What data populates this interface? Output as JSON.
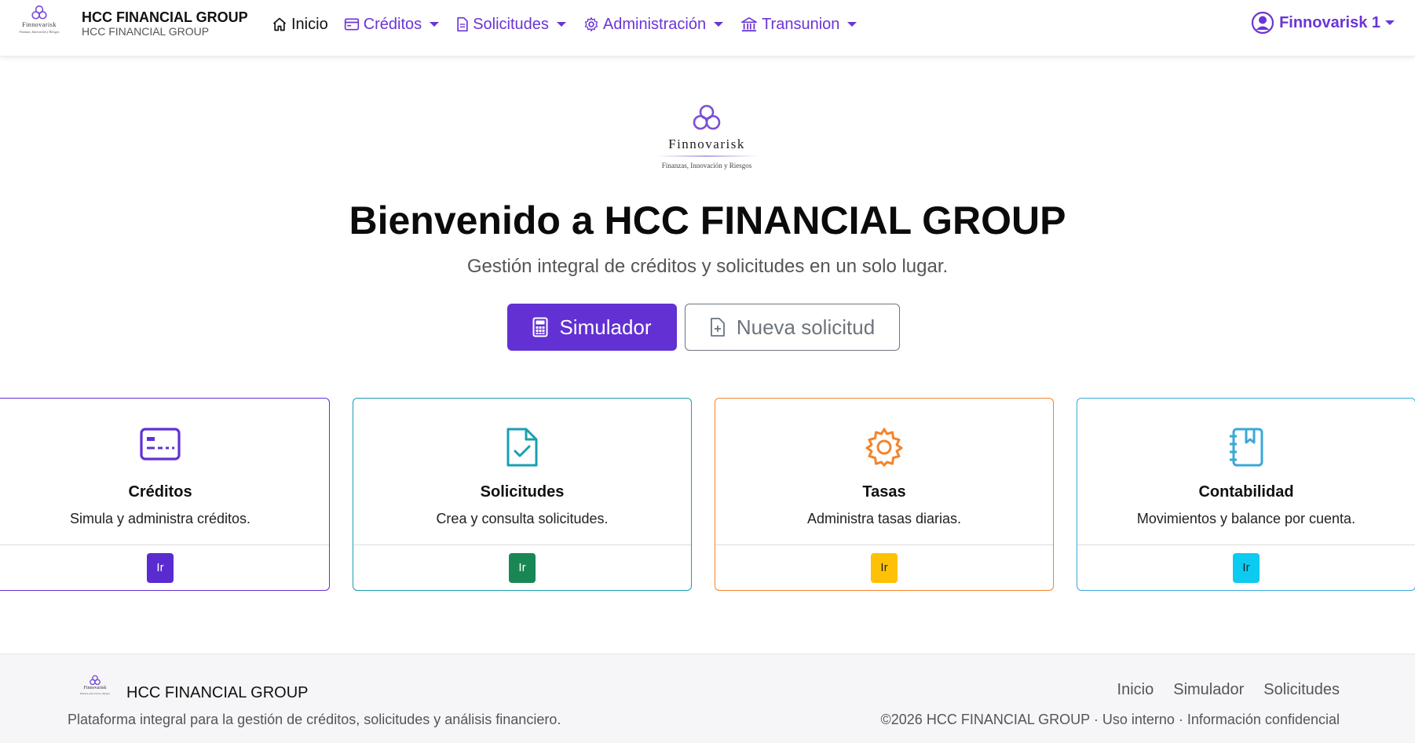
{
  "brand": {
    "logo_word": "Finnovarisk",
    "logo_tagline": "Finanzas, Innovación y Riesgos",
    "title": "HCC FINANCIAL GROUP",
    "subtitle": "HCC FINANCIAL GROUP"
  },
  "nav": {
    "items": [
      {
        "label": "Inicio",
        "icon": "house-icon",
        "dropdown": false
      },
      {
        "label": "Créditos",
        "icon": "credit-card-icon",
        "dropdown": true
      },
      {
        "label": "Solicitudes",
        "icon": "document-icon",
        "dropdown": true
      },
      {
        "label": "Administración",
        "icon": "gear-icon",
        "dropdown": true
      },
      {
        "label": "Transunion",
        "icon": "bank-icon",
        "dropdown": true
      }
    ],
    "user": {
      "label": "Finnovarisk 1",
      "icon": "user-circle-icon"
    }
  },
  "hero": {
    "title": "Bienvenido a HCC FINANCIAL GROUP",
    "subtitle": "Gestión integral de créditos y solicitudes en un solo lugar.",
    "primary_button": "Simulador",
    "secondary_button": "Nueva solicitud"
  },
  "cards": [
    {
      "title": "Créditos",
      "description": "Simula y administra créditos.",
      "button": "Ir",
      "color": "#6230d3",
      "button_color": "#5a2bd0",
      "icon": "credit-card-icon"
    },
    {
      "title": "Solicitudes",
      "description": "Crea y consulta solicitudes.",
      "button": "Ir",
      "color": "#1a9fb0",
      "button_color": "#198754",
      "icon": "document-check-icon"
    },
    {
      "title": "Tasas",
      "description": "Administra tasas diarias.",
      "button": "Ir",
      "color": "#f5842a",
      "button_color": "#ffc107",
      "icon": "gear-icon"
    },
    {
      "title": "Contabilidad",
      "description": "Movimientos y balance por cuenta.",
      "button": "Ir",
      "color": "#3aa8d8",
      "button_color": "#0dcaf0",
      "icon": "ledger-book-icon"
    }
  ],
  "footer": {
    "brand": "HCC FINANCIAL GROUP",
    "description": "Plataforma integral para la gestión de créditos, solicitudes y análisis financiero.",
    "links": [
      "Inicio",
      "Simulador",
      "Solicitudes"
    ],
    "copyright": "©2026 HCC FINANCIAL GROUP · Uso interno · Información confidencial"
  },
  "colors": {
    "accent": "#6230d3",
    "nav_link": "#6a35d6"
  }
}
